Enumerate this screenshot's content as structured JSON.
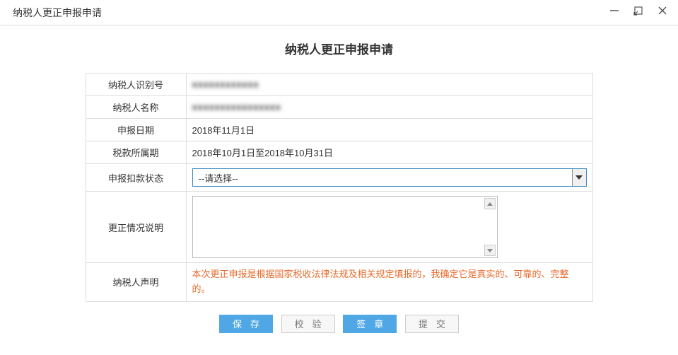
{
  "window": {
    "title": "纳税人更正申报申请"
  },
  "page": {
    "title": "纳税人更正申报申请"
  },
  "form": {
    "taxpayer_id_label": "纳税人识别号",
    "taxpayer_id_value": "■■■■■■■■■■■■",
    "taxpayer_name_label": "纳税人名称",
    "taxpayer_name_value": "■■■■■■■■■■■■■■■■",
    "declare_date_label": "申报日期",
    "declare_date_value": "2018年11月1日",
    "tax_period_label": "税款所属期",
    "tax_period_value": "2018年10月1日至2018年10月31日",
    "deduction_status_label": "申报扣款状态",
    "deduction_status_value": "--请选择--",
    "correction_desc_label": "更正情况说明",
    "correction_desc_value": "",
    "declaration_label": "纳税人声明",
    "declaration_text": "本次更正申报是根据国家税收法律法规及相关规定填报的，我确定它是真实的、可靠的、完整的。"
  },
  "buttons": {
    "save": "保存",
    "verify": "校验",
    "sign": "签章",
    "submit": "提交"
  }
}
